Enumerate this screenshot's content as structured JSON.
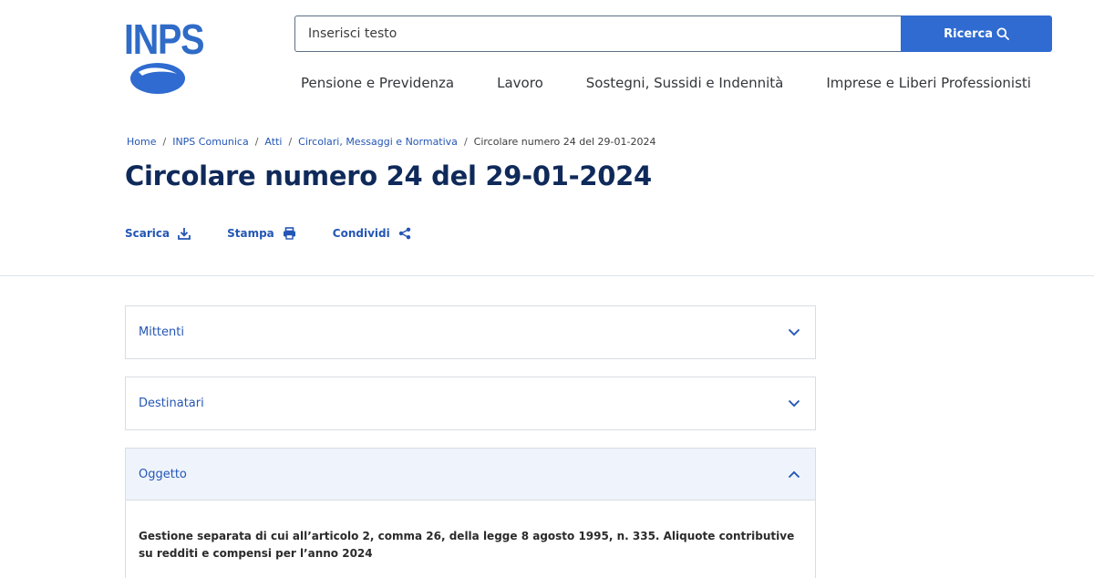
{
  "logo": {
    "text": "INPS",
    "icon": "inps-logo-icon"
  },
  "search": {
    "placeholder": "Inserisci testo",
    "button_label": "Ricerca",
    "icon": "search-icon"
  },
  "nav": {
    "items": [
      {
        "label": "Pensione e Previdenza"
      },
      {
        "label": "Lavoro"
      },
      {
        "label": "Sostegni, Sussidi e Indennità"
      },
      {
        "label": "Imprese e Liberi Professionisti"
      }
    ]
  },
  "breadcrumb": {
    "items": [
      {
        "label": "Home"
      },
      {
        "label": "INPS Comunica"
      },
      {
        "label": "Atti"
      },
      {
        "label": "Circolari, Messaggi e Normativa"
      }
    ],
    "separator": "/",
    "current": "Circolare numero 24 del 29-01-2024"
  },
  "page": {
    "title": "Circolare numero 24 del 29-01-2024"
  },
  "actions": {
    "download_label": "Scarica",
    "print_label": "Stampa",
    "share_label": "Condividi"
  },
  "accordion": {
    "items": [
      {
        "title": "Mittenti",
        "state": "collapsed"
      },
      {
        "title": "Destinatari",
        "state": "collapsed"
      },
      {
        "title": "Oggetto",
        "state": "expanded",
        "body": "Gestione separata di cui all’articolo 2, comma 26, della legge 8 agosto 1995, n. 335. Aliquote contributive su redditi e compensi per l’anno 2024"
      }
    ]
  },
  "colors": {
    "brand": "#2f6bd0",
    "link": "#2456b5",
    "title": "#0f2a5a",
    "open_bg": "#eff4fc"
  }
}
